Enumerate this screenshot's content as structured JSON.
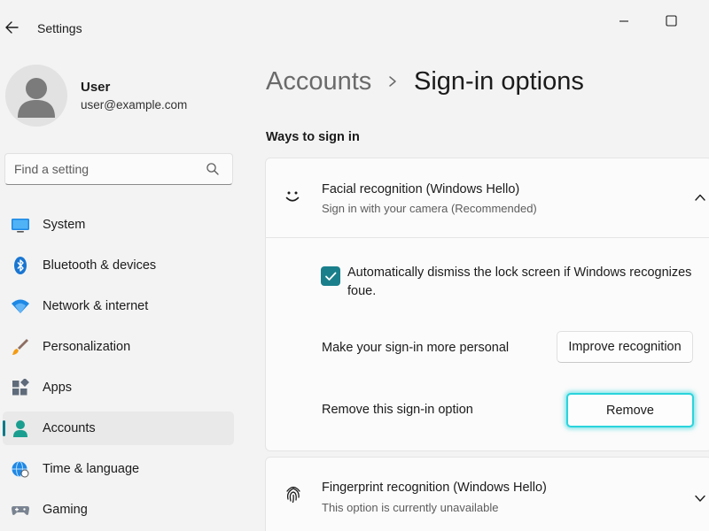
{
  "window": {
    "title": "Settings"
  },
  "profile": {
    "name": "User",
    "email": "user@example.com"
  },
  "search": {
    "placeholder": "Find a setting",
    "value": ""
  },
  "nav": {
    "items": [
      {
        "label": "System",
        "icon": "system-icon"
      },
      {
        "label": "Bluetooth & devices",
        "icon": "bluetooth-icon"
      },
      {
        "label": "Network & internet",
        "icon": "wifi-icon"
      },
      {
        "label": "Personalization",
        "icon": "brush-icon"
      },
      {
        "label": "Apps",
        "icon": "apps-icon"
      },
      {
        "label": "Accounts",
        "icon": "accounts-icon",
        "selected": true
      },
      {
        "label": "Time & language",
        "icon": "globe-icon"
      },
      {
        "label": "Gaming",
        "icon": "gamepad-icon"
      }
    ]
  },
  "header": {
    "parent": "Accounts",
    "current": "Sign-in options"
  },
  "section": {
    "heading": "Ways to sign in"
  },
  "facial": {
    "title": "Facial recognition (Windows Hello)",
    "subtitle": "Sign in with your camera (Recommended)",
    "expanded": true,
    "checkbox_label": "Automatically dismiss the lock screen if Windows recognizes foue.",
    "checkbox_checked": true,
    "personal_label": "Make your sign-in more personal",
    "improve_button": "Improve recognition",
    "remove_label": "Remove this sign-in option",
    "remove_button": "Remove"
  },
  "fingerprint": {
    "title": "Fingerprint recognition (Windows Hello)",
    "subtitle": "This option is currently unavailable",
    "expanded": false
  },
  "colors": {
    "accent": "#1a7f8b",
    "focus_ring": "#2ad4dc",
    "background": "#f3f3f3",
    "card": "#fbfbfb"
  }
}
